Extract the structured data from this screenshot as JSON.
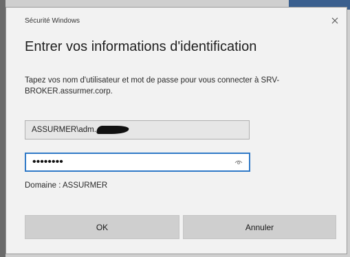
{
  "window": {
    "title": "Sécurité Windows"
  },
  "dialog": {
    "heading": "Entrer vos informations d'identification",
    "description": "Tapez vos nom d'utilisateur et mot de passe pour vous connecter à SRV-BROKER.assurmer.corp.",
    "username_value": "ASSURMER\\adm.",
    "password_mask": "••••••••",
    "domain_label": "Domaine : ASSURMER"
  },
  "buttons": {
    "ok_label": "OK",
    "cancel_label": "Annuler"
  },
  "icons": {
    "close": "close-icon",
    "reveal": "eye-icon"
  },
  "colors": {
    "accent": "#2f79c7",
    "dialog_bg": "#f2f2f2",
    "button_bg": "#cfcfcf"
  }
}
